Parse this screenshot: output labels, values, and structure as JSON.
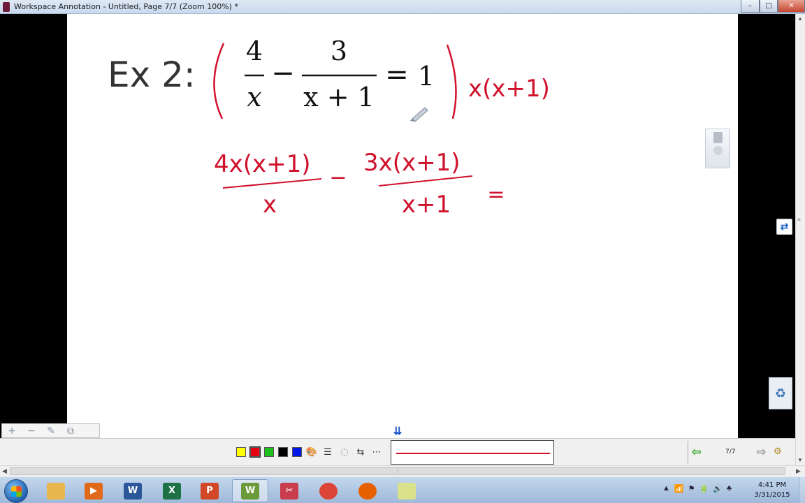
{
  "window": {
    "title": "Workspace Annotation - Untitled, Page 7/7  (Zoom 100%) *",
    "minimize_glyph": "–",
    "maximize_glyph": "□",
    "close_glyph": "✕"
  },
  "page_content": {
    "example_label": "Ex 2:",
    "typed": {
      "n1": "4",
      "d1": "x",
      "minus": "−",
      "n2": "3",
      "d2": "x + 1",
      "eq": "=",
      "rhs": "1"
    },
    "handwritten_multiplier": "x(x+1)",
    "handwritten_step": {
      "num1": "4x(x+1)",
      "den1": "x",
      "minus": "−",
      "num2": "3x(x+1)",
      "den2": "x+1",
      "eq": "="
    },
    "ink_color": "#d0112b"
  },
  "toolbar": {
    "colors": [
      {
        "name": "yellow",
        "hex": "#ffff00"
      },
      {
        "name": "red",
        "hex": "#e60012"
      },
      {
        "name": "green",
        "hex": "#1fbf1f"
      },
      {
        "name": "black",
        "hex": "#000000"
      },
      {
        "name": "blue",
        "hex": "#0017e6"
      }
    ],
    "selected_color": "red",
    "page_indicator": "7/7"
  },
  "zoom_tools": {
    "plus": "+",
    "minus": "−",
    "edit": "✎",
    "copy": "⧉"
  },
  "taskbar": {
    "apps": [
      {
        "name": "file-explorer",
        "label": "",
        "color": "#e7b64c"
      },
      {
        "name": "media-player",
        "label": "▶",
        "color": "#e06a1a"
      },
      {
        "name": "word",
        "label": "W",
        "color": "#2b579a"
      },
      {
        "name": "excel",
        "label": "X",
        "color": "#1e7145"
      },
      {
        "name": "powerpoint",
        "label": "P",
        "color": "#d24726"
      },
      {
        "name": "workspace",
        "label": "W",
        "color": "#6a9a3a"
      },
      {
        "name": "snipping-tool",
        "label": "✂",
        "color": "#c93c4b"
      },
      {
        "name": "chrome",
        "label": "",
        "color": "#db4437"
      },
      {
        "name": "firefox",
        "label": "",
        "color": "#e66000"
      },
      {
        "name": "notes",
        "label": "",
        "color": "#d9e28a"
      }
    ],
    "clock_time": "4:41 PM",
    "clock_date": "3/31/2015"
  }
}
